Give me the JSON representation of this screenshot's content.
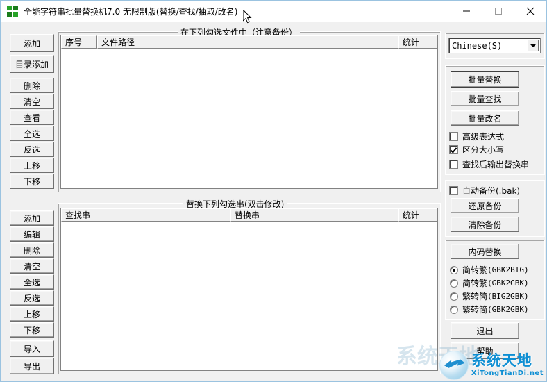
{
  "window": {
    "title": "全能字符串批量替换机7.0 无限制版(替换/查找/抽取/改名)",
    "icon": "app-green-squares-icon",
    "minimize_label": "—",
    "maximize_label": "□",
    "close_label": "✕"
  },
  "file_group": {
    "title": "在下列勾选文件中（注意备份）",
    "columns": [
      "序号",
      "文件路径",
      "统计"
    ],
    "rows": [],
    "buttons": [
      "添加",
      "目录添加",
      "删除",
      "清空",
      "查看",
      "全选",
      "反选",
      "上移",
      "下移"
    ]
  },
  "string_group": {
    "title": "替换下列勾选串(双击修改)",
    "columns": [
      "查找串",
      "替换串",
      "统计"
    ],
    "rows": [],
    "buttons": [
      "添加",
      "编辑",
      "删除",
      "清空",
      "全选",
      "反选",
      "上移",
      "下移",
      "导入",
      "导出"
    ]
  },
  "right_panel": {
    "encoding_combo": {
      "value": "Chinese(S)",
      "options": [
        "Chinese(S)"
      ]
    },
    "action_buttons": [
      {
        "label": "批量替换",
        "default": true
      },
      {
        "label": "批量查找",
        "default": false
      },
      {
        "label": "批量改名",
        "default": false
      }
    ],
    "options": [
      {
        "label": "高级表达式",
        "checked": false
      },
      {
        "label": "区分大小写",
        "checked": true
      },
      {
        "label": "查找后输出替换串",
        "checked": false
      }
    ],
    "backup": {
      "auto_backup": {
        "label": "自动备份(.bak)",
        "checked": false
      },
      "restore_label": "还原备份",
      "clear_label": "清除备份"
    },
    "encoding_convert": {
      "button_label": "内码替换",
      "radios": [
        {
          "label": "简转繁",
          "code": "(GBK2BIG)",
          "checked": true
        },
        {
          "label": "简转繁",
          "code": "(GBK2GBK)",
          "checked": false
        },
        {
          "label": "繁转简",
          "code": "(BIG2GBK)",
          "checked": false
        },
        {
          "label": "繁转简",
          "code": "(GBK2GBK)",
          "checked": false
        }
      ]
    },
    "exit_label": "退出",
    "help_label": "帮助"
  },
  "watermark": {
    "main": "系统天地",
    "sub": "XiTongTianDi.net",
    "ghost": "系统天地"
  },
  "colors": {
    "face": "#f0f0f0",
    "window_border": "#9bc3e0",
    "accent": "#0f8fd3",
    "icon_green": "#27a327"
  }
}
